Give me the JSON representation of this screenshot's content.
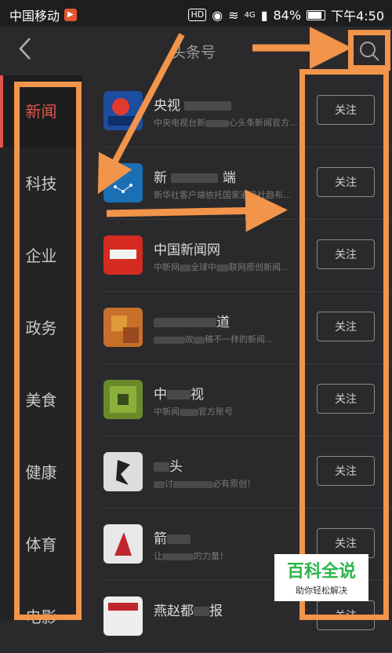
{
  "status_bar": {
    "carrier": "中国移动",
    "hd": "HD",
    "network": "4G",
    "battery": "84%",
    "time": "下午4:50"
  },
  "header": {
    "back_icon": "chevron-left-icon",
    "title": "头条号",
    "search_icon": "search-icon"
  },
  "sidebar": {
    "items": [
      {
        "label": "新闻",
        "active": true
      },
      {
        "label": "科技"
      },
      {
        "label": "企业"
      },
      {
        "label": "政务"
      },
      {
        "label": "美食"
      },
      {
        "label": "健康"
      },
      {
        "label": "体育"
      },
      {
        "label": "电影"
      }
    ]
  },
  "accounts": [
    {
      "name": "央视",
      "desc": "中央电视台新",
      "desc2": "心头条新闻官方...",
      "follow": "关注"
    },
    {
      "name": "新",
      "name2": "端",
      "desc": "新华社客户端依托国家通讯社趋布...",
      "follow": "关注"
    },
    {
      "name": "中国新闻网",
      "desc": "中新网",
      "desc2": "全球中",
      "desc3": "联网原创新闻...",
      "follow": "关注"
    },
    {
      "name": "道",
      "desc": "故",
      "desc2": "稿不一样的新闻...",
      "follow": "关注"
    },
    {
      "name": "中",
      "name2": "视",
      "desc": "中新闻",
      "desc2": "官方账号",
      "follow": "关注"
    },
    {
      "name": "头",
      "desc": "讨",
      "desc2": "必有原创！",
      "follow": "关注"
    },
    {
      "name": "箭",
      "desc": "让",
      "desc2": "的力量！",
      "follow": "关注"
    },
    {
      "name": "燕赵都",
      "name2": "报",
      "desc": "",
      "follow": "关注"
    }
  ],
  "watermark": {
    "title": "百科全说",
    "subtitle": "助你轻松解决"
  },
  "colors": {
    "accent": "#e0554a",
    "annotation": "#f2944a",
    "background": "#2a2a2c"
  }
}
